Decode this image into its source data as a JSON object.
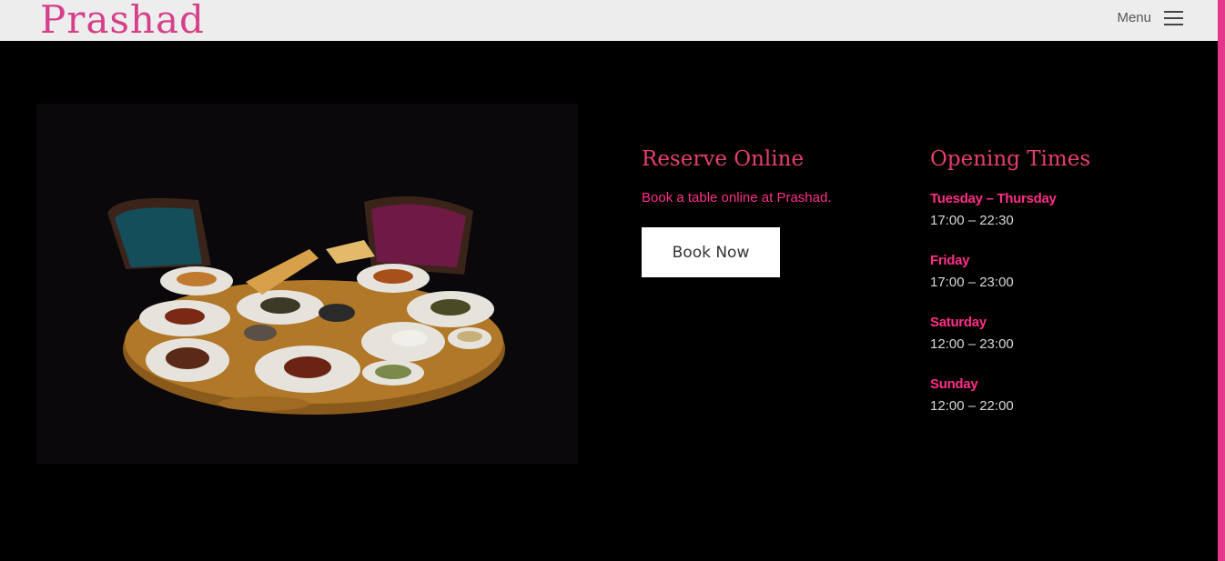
{
  "header": {
    "logo_text": "Prashad",
    "menu_label": "Menu"
  },
  "hero_image": {
    "icon": "food-photo"
  },
  "reserve": {
    "title": "Reserve Online",
    "text": "Book a table online at Prashad.",
    "button_label": "Book Now"
  },
  "opening_times": {
    "title": "Opening Times",
    "days": [
      {
        "name": "Tuesday – Thursday",
        "hours": "17:00 – 22:30"
      },
      {
        "name": "Friday",
        "hours": "17:00 – 23:00"
      },
      {
        "name": "Saturday",
        "hours": "12:00 – 23:00"
      },
      {
        "name": "Sunday",
        "hours": "12:00 – 22:00"
      }
    ]
  },
  "colors": {
    "brand_pink": "#e4368a",
    "title_pink": "#e4406d",
    "text_pink": "#ff2f86"
  }
}
